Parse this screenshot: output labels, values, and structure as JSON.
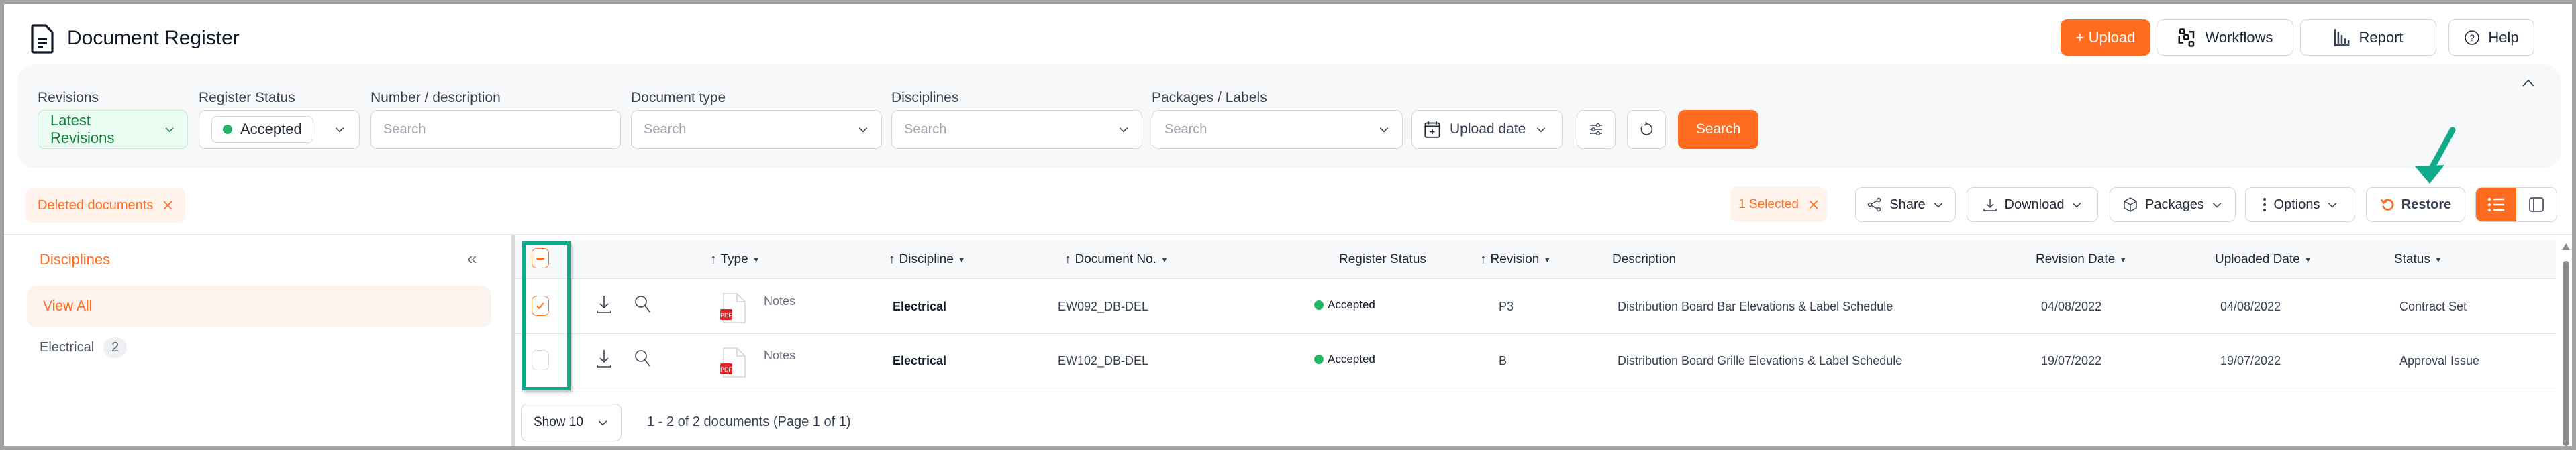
{
  "header": {
    "title": "Document Register",
    "buttons": {
      "upload": "+ Upload",
      "workflows": "Workflows",
      "report": "Report",
      "help": "Help"
    }
  },
  "filters": {
    "revisions": {
      "label": "Revisions",
      "value": "Latest Revisions"
    },
    "register_status": {
      "label": "Register Status",
      "value": "Accepted"
    },
    "number_description": {
      "label": "Number / description",
      "placeholder": "Search"
    },
    "document_type": {
      "label": "Document type",
      "placeholder": "Search"
    },
    "disciplines": {
      "label": "Disciplines",
      "placeholder": "Search"
    },
    "packages_labels": {
      "label": "Packages / Labels",
      "placeholder": "Search"
    },
    "upload_date": "Upload date",
    "search_button": "Search"
  },
  "active_filter_chip": "Deleted documents",
  "actions": {
    "selected": "1 Selected",
    "share": "Share",
    "download": "Download",
    "packages": "Packages",
    "options": "Options",
    "restore": "Restore"
  },
  "sidebar": {
    "title": "Disciplines",
    "items": [
      {
        "label": "View All"
      },
      {
        "label": "Electrical",
        "count": "2"
      }
    ]
  },
  "table": {
    "columns": {
      "type": "Type",
      "discipline": "Discipline",
      "document_no": "Document No.",
      "register_status": "Register Status",
      "revision": "Revision",
      "description": "Description",
      "revision_date": "Revision Date",
      "uploaded_date": "Uploaded Date",
      "status": "Status"
    },
    "rows": [
      {
        "checked": true,
        "type": "Notes",
        "file_badge": "PDF",
        "discipline": "Electrical",
        "document_no": "EW092_DB-DEL",
        "register_status": "Accepted",
        "revision": "P3",
        "description": "Distribution Board Bar Elevations & Label Schedule",
        "revision_date": "04/08/2022",
        "uploaded_date": "04/08/2022",
        "status": "Contract Set"
      },
      {
        "checked": false,
        "type": "Notes",
        "file_badge": "PDF",
        "discipline": "Electrical",
        "document_no": "EW102_DB-DEL",
        "register_status": "Accepted",
        "revision": "B",
        "description": "Distribution Board Grille Elevations & Label Schedule",
        "revision_date": "19/07/2022",
        "uploaded_date": "19/07/2022",
        "status": "Approval Issue"
      }
    ]
  },
  "footer": {
    "page_size": "Show 10",
    "summary": "1 - 2 of 2 documents (Page 1 of 1)"
  },
  "colors": {
    "accent": "#ff6b1f",
    "accepted_green": "#22b566",
    "annotation_teal": "#10a98a"
  }
}
